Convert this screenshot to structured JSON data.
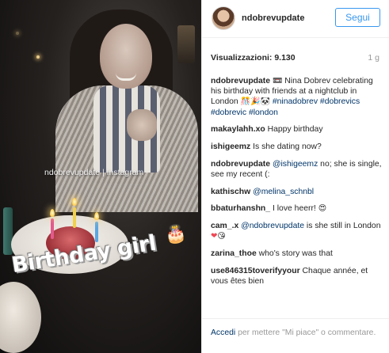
{
  "post": {
    "watermark": "ndobrevupdate | Instagram",
    "sticker_text": "Birthday girl",
    "sticker_icon": "cake-emoji"
  },
  "header": {
    "username": "ndobrevupdate",
    "follow_label": "Segui"
  },
  "stats": {
    "views": "Visualizzazioni: 9.130",
    "time": "1 g"
  },
  "comments": [
    {
      "user": "ndobrevupdate",
      "text": "Nina Dobrev celebrating his birthday with friends at a nightclub in London",
      "hashtags": "#ninadobrev #dobrevics #dobrevic #london"
    },
    {
      "user": "makaylahh.xo",
      "text": "Happy birthday"
    },
    {
      "user": "ishigeemz",
      "text": "Is she dating now?"
    },
    {
      "user": "ndobrevupdate",
      "mention": "@ishigeemz",
      "text": "no; she is single, see my recent (:"
    },
    {
      "user": "kathischw",
      "mention": "@melina_schnbl"
    },
    {
      "user": "bbaturhanshn_",
      "text": "I love heerr!"
    },
    {
      "user": "cam_.x",
      "mention": "@ndobrevupdate",
      "text": "is she still in London"
    },
    {
      "user": "zarina_thoe",
      "text": "who's story was that"
    },
    {
      "user": "use846315toverifyyour",
      "text": "Chaque année, et vous êtes bien"
    }
  ],
  "footer": {
    "login_label": "Accedi",
    "text": "per mettere \"Mi piace\" o commentare."
  },
  "colors": {
    "accent": "#3897f0",
    "link": "#003569",
    "muted": "#999999",
    "heart": "#ed4956"
  }
}
